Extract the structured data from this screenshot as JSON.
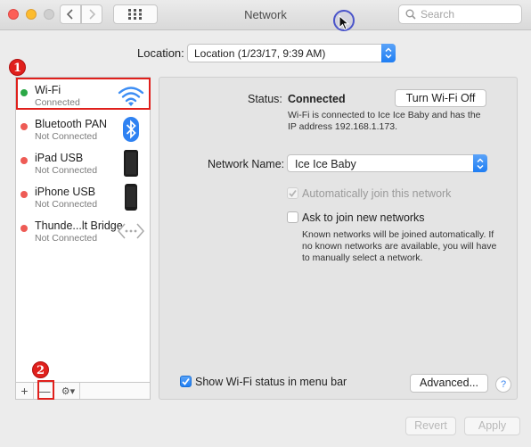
{
  "window": {
    "title": "Network"
  },
  "search": {
    "placeholder": "Search"
  },
  "location": {
    "label": "Location:",
    "value": "Location (1/23/17, 9:39 AM)"
  },
  "services": [
    {
      "name": "Wi-Fi",
      "status": "Connected",
      "dot": "#2aa846",
      "icon": "wifi-icon"
    },
    {
      "name": "Bluetooth PAN",
      "status": "Not Connected",
      "dot": "#ee5b55",
      "icon": "bluetooth-icon"
    },
    {
      "name": "iPad USB",
      "status": "Not Connected",
      "dot": "#ee5b55",
      "icon": "ipad-icon"
    },
    {
      "name": "iPhone USB",
      "status": "Not Connected",
      "dot": "#ee5b55",
      "icon": "iphone-icon"
    },
    {
      "name": "Thunde...lt Bridge",
      "status": "Not Connected",
      "dot": "#ee5b55",
      "icon": "thunderbolt-bridge-icon"
    }
  ],
  "annotations": {
    "one": "1",
    "two": "2",
    "color": "#e0201c"
  },
  "toolbar": {
    "add": "+",
    "remove": "—",
    "gear": "⚙▾"
  },
  "detail": {
    "status_label": "Status:",
    "status_value": "Connected",
    "turn_off_button": "Turn Wi-Fi Off",
    "status_desc_1": "Wi-Fi is connected to Ice Ice Baby and has the",
    "status_desc_2": "IP address 192.168.1.173.",
    "network_name_label": "Network Name:",
    "network_name_value": "Ice Ice Baby",
    "auto_join_label": "Automatically join this network",
    "ask_join_label": "Ask to join new networks",
    "ask_desc_1": "Known networks will be joined automatically. If",
    "ask_desc_2": "no known networks are available, you will have",
    "ask_desc_3": "to manually select a network.",
    "show_status_label": "Show Wi-Fi status in menu bar",
    "advanced_button": "Advanced...",
    "help": "?"
  },
  "footer": {
    "revert": "Revert",
    "apply": "Apply"
  },
  "colors": {
    "accent": "#1f7ef3",
    "connected": "#2aa846",
    "disconnected": "#ee5b55"
  }
}
